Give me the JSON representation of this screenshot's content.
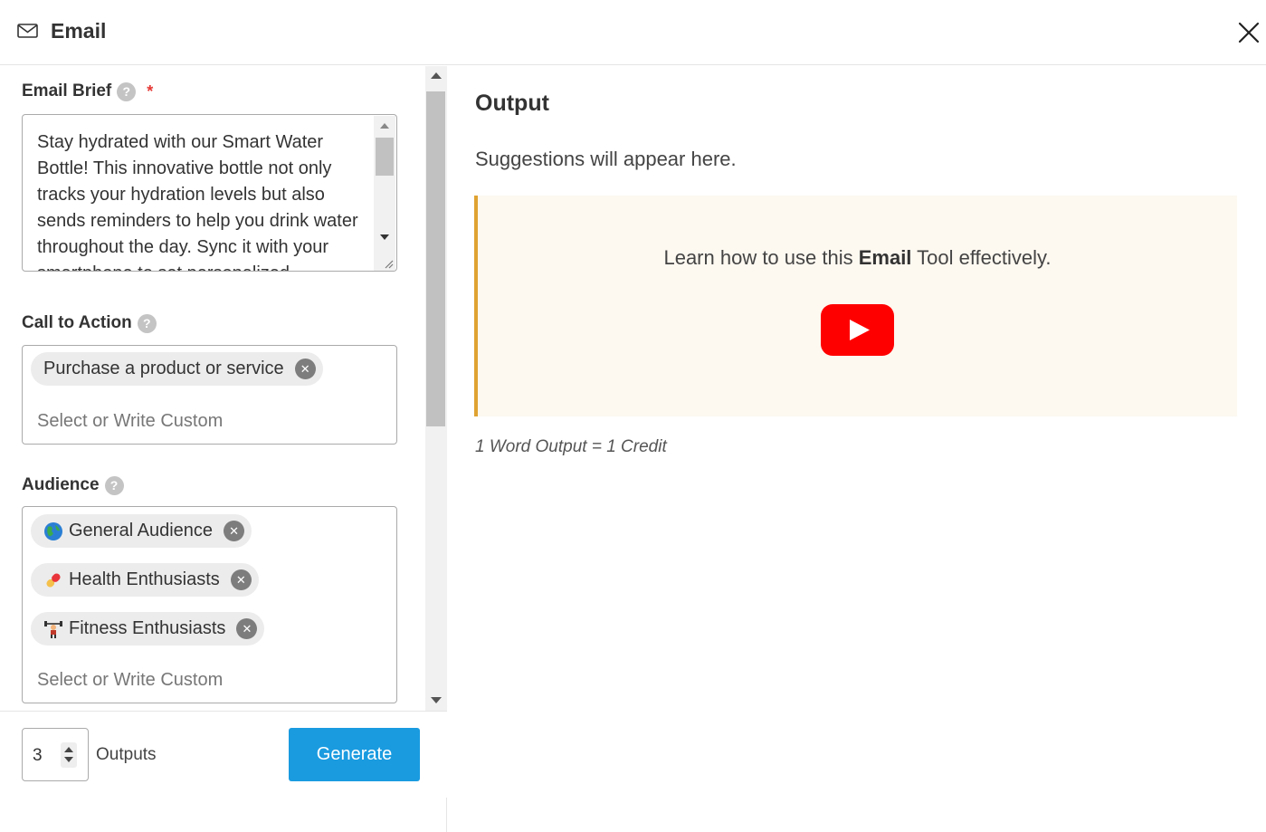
{
  "header": {
    "title": "Email",
    "icon": "mail-icon",
    "close_icon": "close-icon"
  },
  "form": {
    "email_brief": {
      "label": "Email Brief",
      "required_mark": "*",
      "help_icon": "?",
      "value": "Stay hydrated with our Smart Water Bottle! This innovative bottle not only tracks your hydration levels but also sends reminders to help you drink water throughout the day. Sync it with your smartphone to set personalized"
    },
    "call_to_action": {
      "label": "Call to Action",
      "help_icon": "?",
      "chips": [
        "Purchase a product or service"
      ],
      "placeholder": "Select or Write Custom"
    },
    "audience": {
      "label": "Audience",
      "help_icon": "?",
      "chips": [
        {
          "label": "General Audience",
          "emoji": "globe-icon"
        },
        {
          "label": "Health Enthusiasts",
          "emoji": "pill-icon"
        },
        {
          "label": "Fitness Enthusiasts",
          "emoji": "weightlifter-icon"
        }
      ],
      "placeholder": "Select or Write Custom"
    },
    "remove_glyph": "✕"
  },
  "footer": {
    "outputs_value": "3",
    "outputs_label": "Outputs",
    "generate_label": "Generate"
  },
  "output": {
    "title": "Output",
    "suggestions": "Suggestions will appear here.",
    "tip_before": "Learn how to use this ",
    "tip_bold": "Email",
    "tip_after": " Tool effectively.",
    "credit_note": "1 Word Output = 1 Credit"
  },
  "colors": {
    "accent": "#1a9be0",
    "tip_border": "#e0a331",
    "tip_background": "#fdf8f0",
    "youtube_red": "#ff0000",
    "required": "#e53935"
  }
}
